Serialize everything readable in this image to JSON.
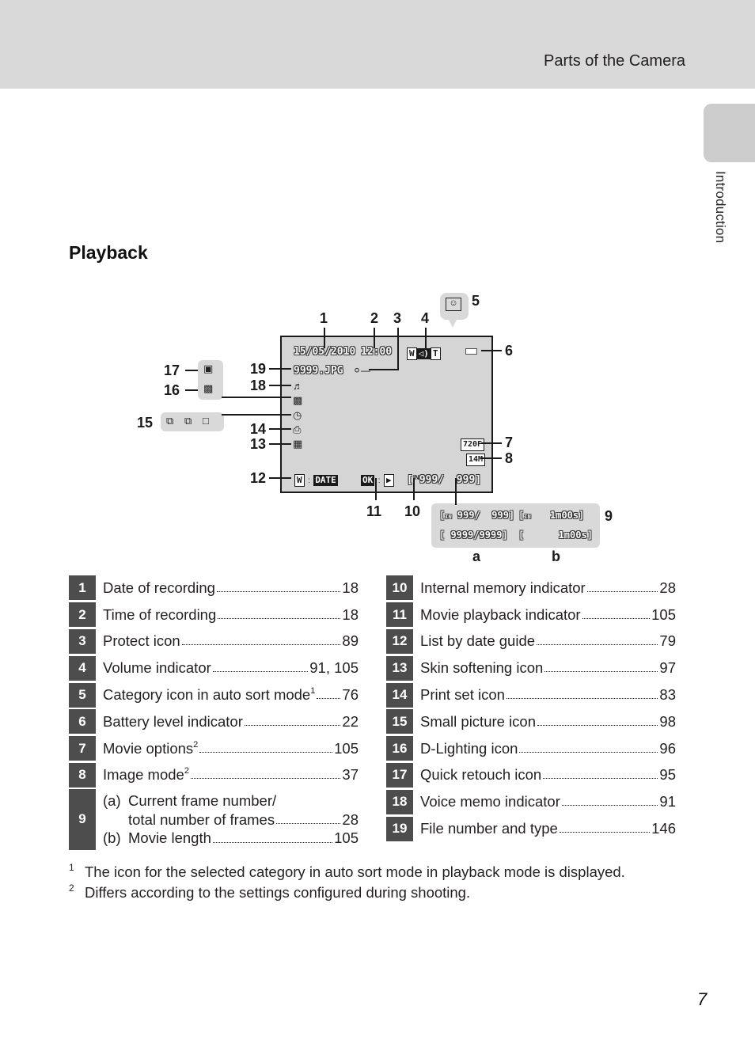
{
  "header": {
    "title": "Parts of the Camera"
  },
  "side_tab": {
    "label": "Introduction"
  },
  "section": {
    "title": "Playback"
  },
  "diagram": {
    "screen": {
      "date": "15/05/2010",
      "time": "12:00",
      "file": "9999.JPG",
      "protect_icon": "key-icon",
      "volume": {
        "w": "W",
        "t": "T",
        "icon": "speaker-icon"
      },
      "battery_icon": "battery-icon",
      "movie_option": "720F",
      "image_mode": "14M",
      "list_by_date": {
        "key": "W",
        "label": "DATE"
      },
      "movie_playback": {
        "key": "OK",
        "icon": "play-icon"
      },
      "frame_counter": "999/  999",
      "memory_badge": "IN"
    },
    "callouts": [
      "1",
      "2",
      "3",
      "4",
      "5",
      "6",
      "7",
      "8",
      "9",
      "10",
      "11",
      "12",
      "13",
      "14",
      "15",
      "16",
      "17",
      "18",
      "19"
    ],
    "counter_panel": {
      "row1_a": "999/  999]",
      "row1_b": "1m00s]",
      "row2_a": "[ 9999/9999]",
      "row2_b": "[      1m00s]",
      "label_a": "a",
      "label_b": "b",
      "badge": "IN"
    }
  },
  "items_left": [
    {
      "num": "1",
      "label": "Date of recording",
      "sup": "",
      "page": "18"
    },
    {
      "num": "2",
      "label": "Time of recording",
      "sup": "",
      "page": "18"
    },
    {
      "num": "3",
      "label": "Protect icon",
      "sup": "",
      "page": "89"
    },
    {
      "num": "4",
      "label": "Volume indicator",
      "sup": "",
      "page": "91, 105"
    },
    {
      "num": "5",
      "label": "Category icon in auto sort mode",
      "sup": "1",
      "page": "76"
    },
    {
      "num": "6",
      "label": "Battery level indicator",
      "sup": "",
      "page": "22"
    },
    {
      "num": "7",
      "label": "Movie options",
      "sup": "2",
      "page": "105"
    },
    {
      "num": "8",
      "label": "Image mode",
      "sup": "2",
      "page": "37"
    }
  ],
  "item9": {
    "num": "9",
    "a_marker": "(a)",
    "a_line1": "Current frame number/",
    "a_line2": "total number of frames",
    "a_page": "28",
    "b_marker": "(b)",
    "b_label": "Movie length",
    "b_page": "105"
  },
  "items_right": [
    {
      "num": "10",
      "label": "Internal memory indicator",
      "page": "28"
    },
    {
      "num": "11",
      "label": "Movie playback indicator",
      "page": "105"
    },
    {
      "num": "12",
      "label": "List by date guide",
      "page": "79"
    },
    {
      "num": "13",
      "label": "Skin softening icon",
      "page": "97"
    },
    {
      "num": "14",
      "label": "Print set icon",
      "page": "83"
    },
    {
      "num": "15",
      "label": "Small picture icon",
      "page": "98"
    },
    {
      "num": "16",
      "label": "D-Lighting icon",
      "page": "96"
    },
    {
      "num": "17",
      "label": "Quick retouch icon",
      "page": "95"
    },
    {
      "num": "18",
      "label": "Voice memo indicator",
      "page": "91"
    },
    {
      "num": "19",
      "label": "File number and type",
      "page": "146"
    }
  ],
  "footnotes": [
    {
      "mark": "1",
      "text": "The icon for the selected category in auto sort mode in playback mode is displayed."
    },
    {
      "mark": "2",
      "text": "Differs according to the settings configured during shooting."
    }
  ],
  "page_number": "7",
  "colors": {
    "header_band": "#d9d9d9",
    "number_box": "#4d4d4d",
    "lcd_bg": "#d5d5d5"
  }
}
